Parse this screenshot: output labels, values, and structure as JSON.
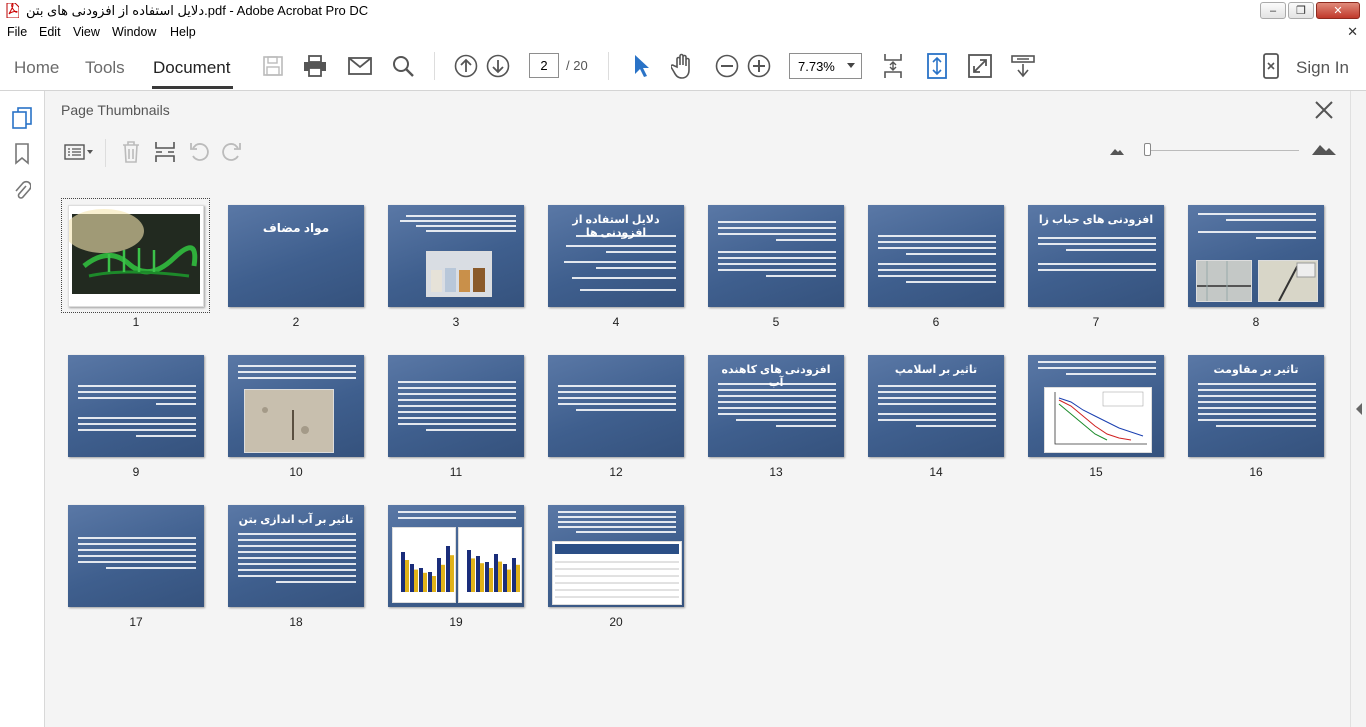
{
  "window": {
    "title": "دلایل استفاده از افزودنی های بتن.pdf - Adobe Acrobat Pro DC",
    "minimize": "–",
    "restore": "❐",
    "close": "✕"
  },
  "menu": {
    "items": [
      "File",
      "Edit",
      "View",
      "Window",
      "Help"
    ],
    "close_glyph": "✕"
  },
  "toolbar": {
    "tabs": [
      "Home",
      "Tools",
      "Document"
    ],
    "active_tab": "Document",
    "current_page": "2",
    "page_total": "/ 20",
    "zoom": "7.73%",
    "sign_in": "Sign In",
    "icons": [
      "save-icon",
      "print-icon",
      "email-icon",
      "search-icon",
      "prev-page-icon",
      "next-page-icon",
      "select-tool-icon",
      "hand-tool-icon",
      "zoom-out-icon",
      "zoom-in-icon",
      "fit-page-icon",
      "scroll-mode-icon",
      "full-screen-icon",
      "read-mode-icon",
      "mobile-link-icon"
    ]
  },
  "left_rail": {
    "icons": [
      "page-thumbnails-icon",
      "bookmarks-icon",
      "attachments-icon"
    ]
  },
  "panel": {
    "title": "Page Thumbnails",
    "close_glyph": "✕",
    "tools": [
      "options-menu-icon",
      "delete-pages-icon",
      "insert-pages-icon",
      "rotate-left-icon",
      "rotate-right-icon"
    ]
  },
  "colors": {
    "slide_bg": "#3f5f8e",
    "accent_blue": "#2a73c7",
    "text": "#222222"
  },
  "thumbnails": [
    {
      "page": "1",
      "kind": "calligraphy"
    },
    {
      "page": "2",
      "title": "مواد مضاف"
    },
    {
      "page": "3",
      "kind": "photo-jars"
    },
    {
      "page": "4",
      "title": "دلایل استفاده از افزودنی ها"
    },
    {
      "page": "5"
    },
    {
      "page": "6"
    },
    {
      "page": "7",
      "title": "افزودنی های حباب زا"
    },
    {
      "page": "8",
      "kind": "photo-pair"
    },
    {
      "page": "9"
    },
    {
      "page": "10",
      "kind": "photo-wall"
    },
    {
      "page": "11"
    },
    {
      "page": "12"
    },
    {
      "page": "13",
      "title": "افزودنی های کاهنده آب"
    },
    {
      "page": "14",
      "title": "تاثیر بر اسلامپ"
    },
    {
      "page": "15",
      "kind": "chart-slide"
    },
    {
      "page": "16",
      "title": "تاثیر بر مقاومت"
    },
    {
      "page": "17"
    },
    {
      "page": "18",
      "title": "تاثیر بر آب اندازی بتن"
    },
    {
      "page": "19",
      "kind": "bar-slide"
    },
    {
      "page": "20",
      "kind": "table-slide"
    }
  ]
}
